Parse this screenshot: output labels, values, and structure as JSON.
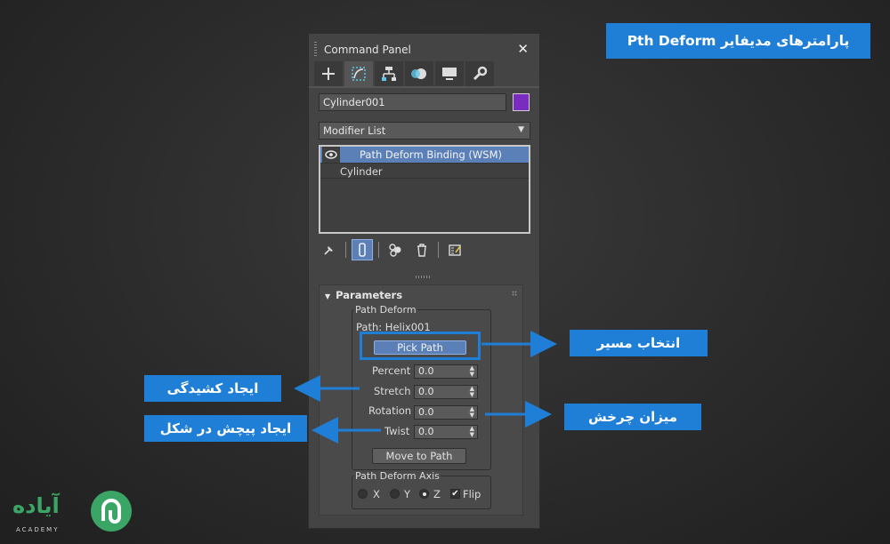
{
  "panel": {
    "title": "Command Panel",
    "close": "✕",
    "tabs": [
      "create-tab",
      "modify-tab",
      "hierarchy-tab",
      "motion-tab",
      "display-tab",
      "utilities-tab"
    ],
    "object_name": "Cylinder001",
    "object_color": "#7a2bc0",
    "modifier_list": "Modifier List",
    "stack": [
      "Path Deform Binding (WSM)",
      "Cylinder"
    ]
  },
  "parameters": {
    "heading": "Parameters",
    "path_deform": {
      "group_label": "Path Deform",
      "path_label": "Path: Helix001",
      "pick_path": "Pick Path",
      "percent_label": "Percent",
      "percent_value": "0.0",
      "stretch_label": "Stretch",
      "stretch_value": "0.0",
      "rotation_label": "Rotation",
      "rotation_value": "0.0",
      "twist_label": "Twist",
      "twist_value": "0.0",
      "move_to_path": "Move to Path"
    },
    "axis": {
      "group_label": "Path Deform Axis",
      "x": "X",
      "y": "Y",
      "z": "Z",
      "selected": "Z",
      "flip": "Flip",
      "flip_checked": true
    }
  },
  "callouts": {
    "title": "پارامترهای مدیفایر Pth Deform",
    "pick_path": "انتخاب مسیر",
    "stretch": "ایجاد کشیدگی",
    "rotation": "میزان چرخش",
    "twist": "ایجاد پیچش در شکل"
  },
  "colors": {
    "accent": "#1f7fd6",
    "selection": "#5b80b8",
    "logo": "#3aa564"
  },
  "logo": {
    "text": "آیاده",
    "sub": "ACADEMY"
  }
}
